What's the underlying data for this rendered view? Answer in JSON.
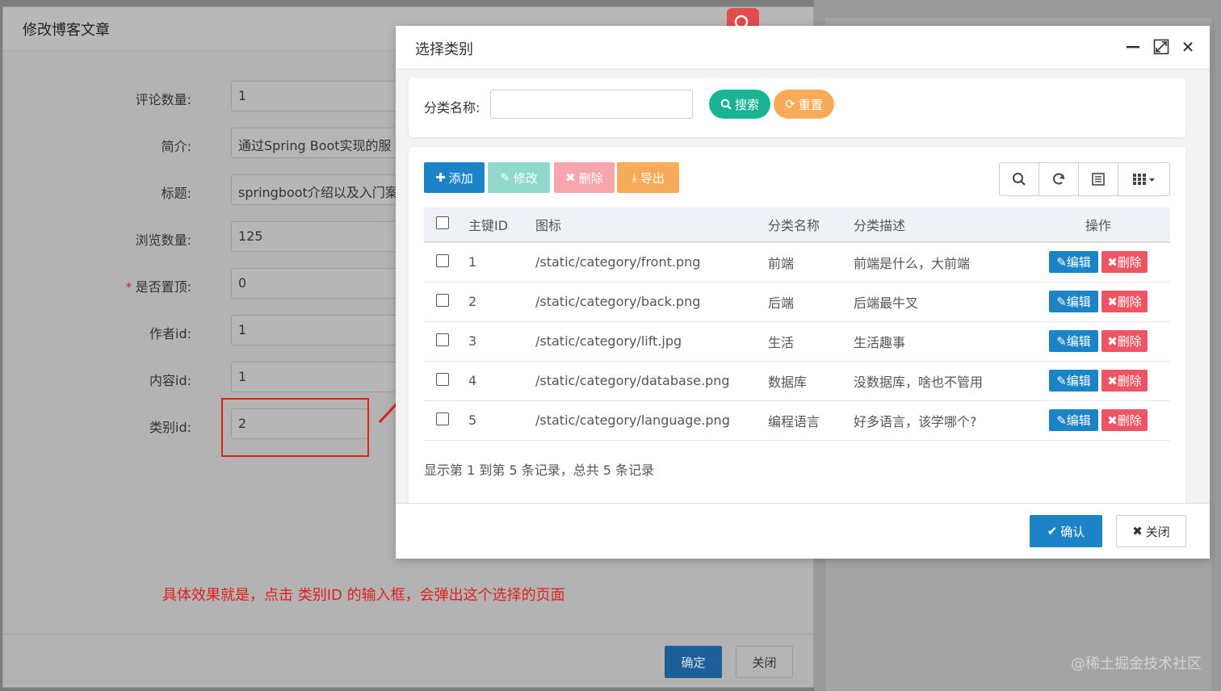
{
  "outer_dialog": {
    "title": "修改博客文章",
    "fields": [
      {
        "label": "评论数量:",
        "value": "1",
        "required": false
      },
      {
        "label": "简介:",
        "value": "通过Spring Boot实现的服",
        "required": false
      },
      {
        "label": "标题:",
        "value": "springboot介绍以及入门案",
        "required": false
      },
      {
        "label": "浏览数量:",
        "value": "125",
        "required": false
      },
      {
        "label": "是否置顶:",
        "value": "0",
        "required": true
      },
      {
        "label": "作者id:",
        "value": "1",
        "required": false
      },
      {
        "label": "内容id:",
        "value": "1",
        "required": false
      },
      {
        "label": "类别id:",
        "value": "2",
        "required": false
      }
    ],
    "annotation": "具体效果就是，点击 类别ID 的输入框，会弹出这个选择的页面",
    "confirm_label": "确定",
    "close_label": "关闭",
    "required_mark": "*"
  },
  "modal": {
    "title": "选择类别",
    "search": {
      "label": "分类名称:",
      "placeholder": "",
      "search_label": "搜索",
      "reset_label": "重置"
    },
    "toolbar": {
      "add_label": "添加",
      "edit_label": "修改",
      "delete_label": "删除",
      "export_label": "导出"
    },
    "table": {
      "columns": [
        "主键ID",
        "图标",
        "分类名称",
        "分类描述",
        "操作"
      ],
      "rows": [
        {
          "id": "1",
          "icon": "/static/category/front.png",
          "name": "前端",
          "desc": "前端是什么，大前端"
        },
        {
          "id": "2",
          "icon": "/static/category/back.png",
          "name": "后端",
          "desc": "后端最牛叉"
        },
        {
          "id": "3",
          "icon": "/static/category/lift.jpg",
          "name": "生活",
          "desc": "生活趣事"
        },
        {
          "id": "4",
          "icon": "/static/category/database.png",
          "name": "数据库",
          "desc": "没数据库，啥也不管用"
        },
        {
          "id": "5",
          "icon": "/static/category/language.png",
          "name": "编程语言",
          "desc": "好多语言，该学哪个?"
        }
      ],
      "row_edit_label": "编辑",
      "row_delete_label": "删除"
    },
    "pager_text": "显示第 1 到第 5 条记录，总共 5 条记录",
    "confirm_label": "确认",
    "close_label": "关闭"
  },
  "watermark": "@稀土掘金技术社区",
  "colors": {
    "primary": "#1c84c6",
    "success": "#1ab394",
    "warning": "#f8ac59",
    "danger": "#ed5565",
    "annotation_red": "#e0201c"
  }
}
